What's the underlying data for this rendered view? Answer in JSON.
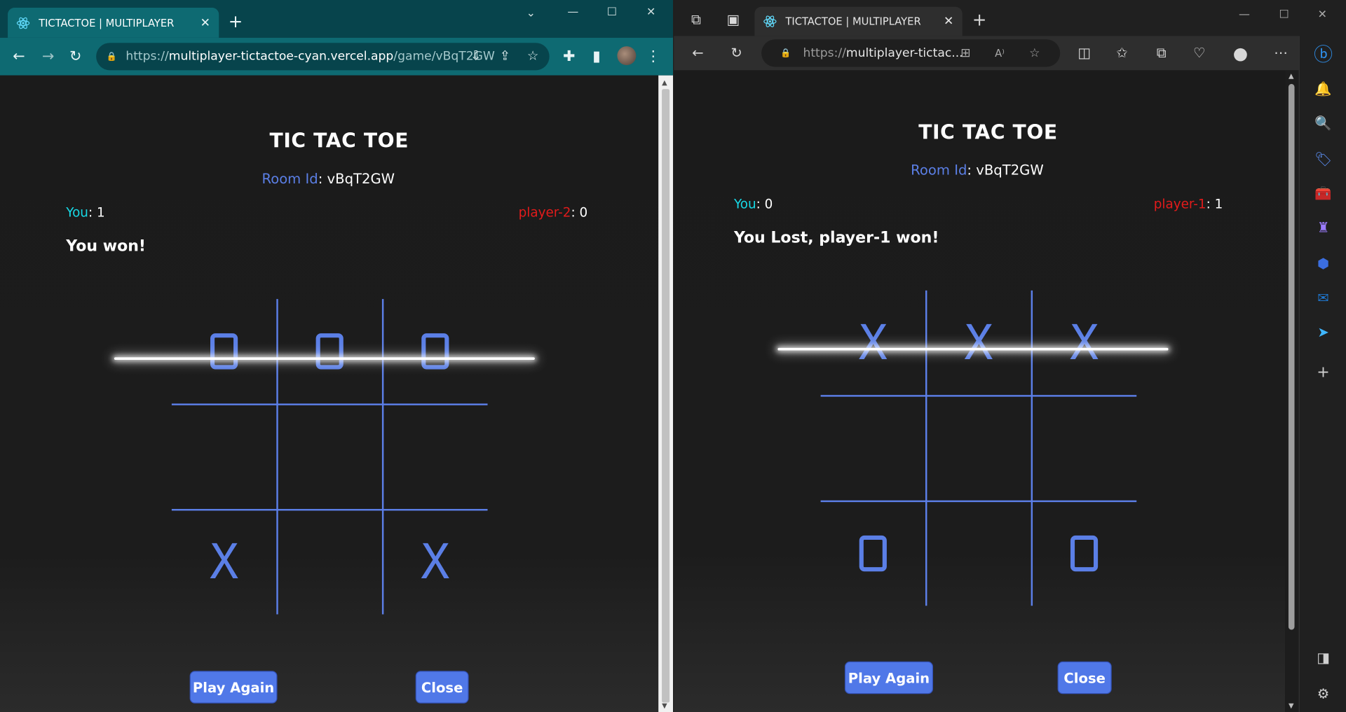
{
  "chrome": {
    "tab_title": "TICTACTOE | MULTIPLAYER",
    "url_prefix": "https://",
    "url_host": "multiplayer-tictactoe-cyan.vercel.app",
    "url_path": "/game/vBqT2GW"
  },
  "edge": {
    "tab_title": "TICTACTOE | MULTIPLAYER",
    "url_prefix": "https://",
    "url_host": "multiplayer-tictac..."
  },
  "game_left": {
    "title": "TIC TAC TOE",
    "room_label": "Room Id",
    "room_id": ": vBqT2GW",
    "you_label": "You",
    "you_score": ": 1",
    "opponent_label": "player-2",
    "opponent_score": ": 0",
    "status": "You won!",
    "board": [
      "O",
      "O",
      "O",
      "",
      "",
      "",
      "X",
      "",
      "X"
    ],
    "play_again": "Play Again",
    "close": "Close"
  },
  "game_right": {
    "title": "TIC TAC TOE",
    "room_label": "Room Id",
    "room_id": ": vBqT2GW",
    "you_label": "You",
    "you_score": ": 0",
    "opponent_label": "player-1",
    "opponent_score": ": 1",
    "status": "You Lost, player-1 won!",
    "board": [
      "X",
      "X",
      "X",
      "",
      "",
      "",
      "O",
      "",
      "O"
    ],
    "play_again": "Play Again",
    "close": "Close"
  },
  "colors": {
    "accent_blue": "#5b7fe6",
    "you_cyan": "#17d9e6",
    "opponent_red": "#e21b1b",
    "chrome_teal": "#0e6a72"
  }
}
